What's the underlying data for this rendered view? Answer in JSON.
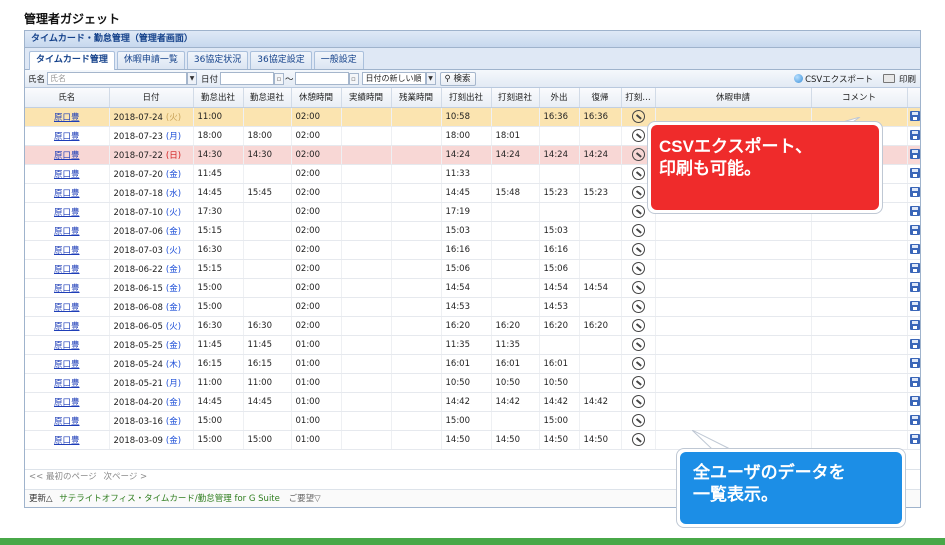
{
  "page_title": "管理者ガジェット",
  "panel_title": "タイムカード・勤怠管理（管理者画面）",
  "tabs": [
    {
      "label": "タイムカード管理",
      "active": true
    },
    {
      "label": "休暇申請一覧",
      "active": false
    },
    {
      "label": "36協定状況",
      "active": false
    },
    {
      "label": "36協定設定",
      "active": false
    },
    {
      "label": "一般設定",
      "active": false
    }
  ],
  "toolbar": {
    "name_label": "氏名",
    "name_placeholder": "氏名",
    "date_label": "日付",
    "range_sep": "～",
    "sort_value": "日付の新しい順",
    "search_label": "検索",
    "csv_label": "CSVエクスポート",
    "print_label": "印刷"
  },
  "columns": [
    "氏名",
    "日付",
    "勤怠出社",
    "勤怠退社",
    "休憩時間",
    "実績時間",
    "残業時間",
    "打刻出社",
    "打刻退社",
    "外出",
    "復帰",
    "打刻…",
    "休暇申請",
    "コメント",
    ""
  ],
  "rows": [
    {
      "name": "原口豊",
      "date": "2018-07-24",
      "dow": "(火)",
      "dow_type": "gray",
      "row_type": "today",
      "in": "11:00",
      "out": "",
      "break": "02:00",
      "actual": "",
      "overtime": "",
      "stamp_in": "10:58",
      "stamp_out": "",
      "go_out": "16:36",
      "return": "16:36"
    },
    {
      "name": "原口豊",
      "date": "2018-07-23",
      "dow": "(月)",
      "dow_type": "blue",
      "row_type": "",
      "in": "18:00",
      "out": "18:00",
      "break": "02:00",
      "actual": "",
      "overtime": "",
      "stamp_in": "18:00",
      "stamp_out": "18:01",
      "go_out": "",
      "return": ""
    },
    {
      "name": "原口豊",
      "date": "2018-07-22",
      "dow": "(日)",
      "dow_type": "red",
      "row_type": "sunday",
      "in": "14:30",
      "out": "14:30",
      "break": "02:00",
      "actual": "",
      "overtime": "",
      "stamp_in": "14:24",
      "stamp_out": "14:24",
      "go_out": "14:24",
      "return": "14:24"
    },
    {
      "name": "原口豊",
      "date": "2018-07-20",
      "dow": "(金)",
      "dow_type": "blue",
      "row_type": "",
      "in": "11:45",
      "out": "",
      "break": "02:00",
      "actual": "",
      "overtime": "",
      "stamp_in": "11:33",
      "stamp_out": "",
      "go_out": "",
      "return": ""
    },
    {
      "name": "原口豊",
      "date": "2018-07-18",
      "dow": "(水)",
      "dow_type": "blue",
      "row_type": "",
      "in": "14:45",
      "out": "15:45",
      "break": "02:00",
      "actual": "",
      "overtime": "",
      "stamp_in": "14:45",
      "stamp_out": "15:48",
      "go_out": "15:23",
      "return": "15:23"
    },
    {
      "name": "原口豊",
      "date": "2018-07-10",
      "dow": "(火)",
      "dow_type": "blue",
      "row_type": "",
      "in": "17:30",
      "out": "",
      "break": "02:00",
      "actual": "",
      "overtime": "",
      "stamp_in": "17:19",
      "stamp_out": "",
      "go_out": "",
      "return": ""
    },
    {
      "name": "原口豊",
      "date": "2018-07-06",
      "dow": "(金)",
      "dow_type": "blue",
      "row_type": "",
      "in": "15:15",
      "out": "",
      "break": "02:00",
      "actual": "",
      "overtime": "",
      "stamp_in": "15:03",
      "stamp_out": "",
      "go_out": "15:03",
      "return": ""
    },
    {
      "name": "原口豊",
      "date": "2018-07-03",
      "dow": "(火)",
      "dow_type": "blue",
      "row_type": "",
      "in": "16:30",
      "out": "",
      "break": "02:00",
      "actual": "",
      "overtime": "",
      "stamp_in": "16:16",
      "stamp_out": "",
      "go_out": "16:16",
      "return": ""
    },
    {
      "name": "原口豊",
      "date": "2018-06-22",
      "dow": "(金)",
      "dow_type": "blue",
      "row_type": "",
      "in": "15:15",
      "out": "",
      "break": "02:00",
      "actual": "",
      "overtime": "",
      "stamp_in": "15:06",
      "stamp_out": "",
      "go_out": "15:06",
      "return": ""
    },
    {
      "name": "原口豊",
      "date": "2018-06-15",
      "dow": "(金)",
      "dow_type": "blue",
      "row_type": "",
      "in": "15:00",
      "out": "",
      "break": "02:00",
      "actual": "",
      "overtime": "",
      "stamp_in": "14:54",
      "stamp_out": "",
      "go_out": "14:54",
      "return": "14:54"
    },
    {
      "name": "原口豊",
      "date": "2018-06-08",
      "dow": "(金)",
      "dow_type": "blue",
      "row_type": "",
      "in": "15:00",
      "out": "",
      "break": "02:00",
      "actual": "",
      "overtime": "",
      "stamp_in": "14:53",
      "stamp_out": "",
      "go_out": "14:53",
      "return": ""
    },
    {
      "name": "原口豊",
      "date": "2018-06-05",
      "dow": "(火)",
      "dow_type": "blue",
      "row_type": "",
      "in": "16:30",
      "out": "16:30",
      "break": "02:00",
      "actual": "",
      "overtime": "",
      "stamp_in": "16:20",
      "stamp_out": "16:20",
      "go_out": "16:20",
      "return": "16:20"
    },
    {
      "name": "原口豊",
      "date": "2018-05-25",
      "dow": "(金)",
      "dow_type": "blue",
      "row_type": "",
      "in": "11:45",
      "out": "11:45",
      "break": "01:00",
      "actual": "",
      "overtime": "",
      "stamp_in": "11:35",
      "stamp_out": "11:35",
      "go_out": "",
      "return": ""
    },
    {
      "name": "原口豊",
      "date": "2018-05-24",
      "dow": "(木)",
      "dow_type": "blue",
      "row_type": "",
      "in": "16:15",
      "out": "16:15",
      "break": "01:00",
      "actual": "",
      "overtime": "",
      "stamp_in": "16:01",
      "stamp_out": "16:01",
      "go_out": "16:01",
      "return": ""
    },
    {
      "name": "原口豊",
      "date": "2018-05-21",
      "dow": "(月)",
      "dow_type": "blue",
      "row_type": "",
      "in": "11:00",
      "out": "11:00",
      "break": "01:00",
      "actual": "",
      "overtime": "",
      "stamp_in": "10:50",
      "stamp_out": "10:50",
      "go_out": "10:50",
      "return": ""
    },
    {
      "name": "原口豊",
      "date": "2018-04-20",
      "dow": "(金)",
      "dow_type": "blue",
      "row_type": "",
      "in": "14:45",
      "out": "14:45",
      "break": "01:00",
      "actual": "",
      "overtime": "",
      "stamp_in": "14:42",
      "stamp_out": "14:42",
      "go_out": "14:42",
      "return": "14:42"
    },
    {
      "name": "原口豊",
      "date": "2018-03-16",
      "dow": "(金)",
      "dow_type": "blue",
      "row_type": "",
      "in": "15:00",
      "out": "",
      "break": "01:00",
      "actual": "",
      "overtime": "",
      "stamp_in": "15:00",
      "stamp_out": "",
      "go_out": "15:00",
      "return": ""
    },
    {
      "name": "原口豊",
      "date": "2018-03-09",
      "dow": "(金)",
      "dow_type": "blue",
      "row_type": "",
      "in": "15:00",
      "out": "15:00",
      "break": "01:00",
      "actual": "",
      "overtime": "",
      "stamp_in": "14:50",
      "stamp_out": "14:50",
      "go_out": "14:50",
      "return": "14:50"
    }
  ],
  "pager": {
    "first": "<< 最初のページ",
    "next": "次ページ >"
  },
  "footer": {
    "update": "更新△",
    "app_link": "サテライトオフィス・タイムカード/勤怠管理 for G Suite",
    "request": "ご要望▽"
  },
  "callouts": {
    "export": [
      "CSVエクスポート、",
      "印刷も可能。"
    ],
    "all_users": [
      "全ユーザのデータを",
      "一覧表示。"
    ]
  },
  "colors": {
    "callout_red": "#ef2b2b",
    "callout_blue": "#1c8ee6",
    "bottom_band": "#48a848",
    "today_row": "#fbe4b0",
    "sunday_row": "#f8d7d5",
    "link": "#1e3eb8"
  },
  "icons": {
    "csv": "csv-export-icon",
    "print": "printer-icon",
    "stamp": "stamp-clock-icon",
    "save": "save-disk-icon",
    "search": "search-icon",
    "calendar": "calendar-icon"
  }
}
